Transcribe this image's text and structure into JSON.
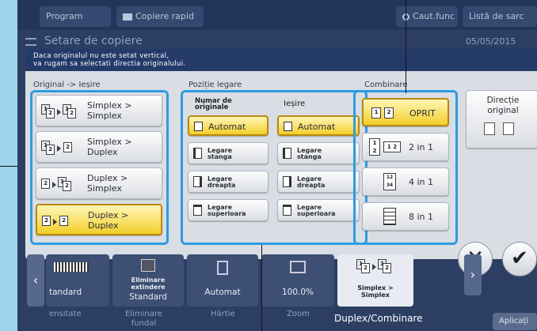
{
  "topbar": {
    "program": "Program",
    "copiere": "Copiere rapid",
    "search": "Caut.func",
    "list": "Listă de sarc"
  },
  "second_row": {
    "title": "Setare de copiere",
    "date": "05/05/2015"
  },
  "dialog": {
    "banner_line1": "Daca originalul nu este setat vertical,",
    "banner_line2": "va rugam sa selectati directia originalului.",
    "group_orig": {
      "label": "Original -> Ieșire",
      "options": [
        {
          "l1": "Simplex >",
          "l2": "Simplex",
          "selected": false
        },
        {
          "l1": "Simplex >",
          "l2": "Duplex",
          "selected": false
        },
        {
          "l1": "Duplex >",
          "l2": "Simplex",
          "selected": false
        },
        {
          "l1": "Duplex >",
          "l2": "Duplex",
          "selected": true
        }
      ]
    },
    "group_binding": {
      "label": "Poziție legare",
      "col1_header_l1": "Numar de",
      "col1_header_l2": "originale",
      "col2_header": "Ieșire",
      "rows": [
        {
          "l1": "Automat",
          "l2": "",
          "selected": true
        },
        {
          "l1": "Legare",
          "l2": "stanga",
          "selected": false
        },
        {
          "l1": "Legare",
          "l2": "dreapta",
          "selected": false
        },
        {
          "l1": "Legare",
          "l2": "superioara",
          "selected": false
        }
      ]
    },
    "group_combine": {
      "label": "Combinare",
      "options": [
        {
          "label": "OPRIT",
          "selected": true
        },
        {
          "label": "2 in 1",
          "selected": false
        },
        {
          "label": "4 in 1",
          "selected": false
        },
        {
          "label": "8 in 1",
          "selected": false
        }
      ]
    },
    "direction": {
      "l1": "Direcție",
      "l2": "original"
    }
  },
  "bottom": {
    "tiles": [
      {
        "l1": "tandard",
        "l2": "",
        "l3": "",
        "cap_l1": "ensitate",
        "cap_l2": ""
      },
      {
        "l1": "Eliminare",
        "l2": "extindere",
        "l3": "Standard",
        "cap_l1": "Eliminare",
        "cap_l2": "fundal"
      },
      {
        "l1": "Automat",
        "l2": "",
        "l3": "",
        "cap_l1": "Hârtie",
        "cap_l2": ""
      },
      {
        "l1": "100.0%",
        "l2": "",
        "l3": "",
        "cap_l1": "Zoom",
        "cap_l2": ""
      },
      {
        "l1": "Simplex >",
        "l2": "Simplex",
        "l3": "",
        "cap_l1": "Duplex/Combinare",
        "cap_l2": ""
      }
    ],
    "app_button": "Aplicați"
  },
  "colors": {
    "accent_frame": "#2f9be0",
    "selected_fill": "#f2cf2a",
    "banner": "#243a68",
    "screen_bg": "#2c3f63",
    "outer_bg": "#9ed3ea"
  }
}
